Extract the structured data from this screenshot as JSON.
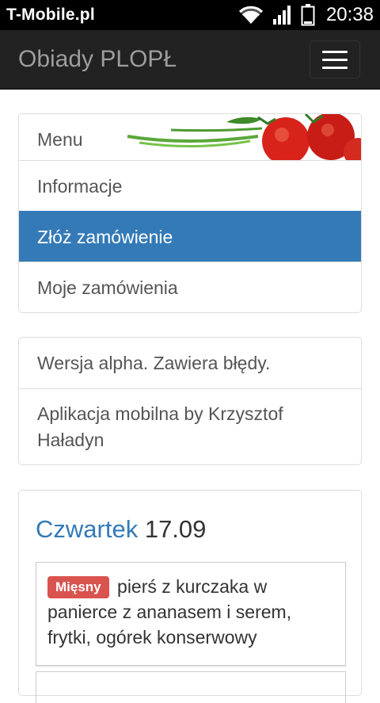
{
  "status_bar": {
    "carrier": "T-Mobile.pl",
    "time": "20:38",
    "icons": [
      "wifi-icon",
      "signal-icon",
      "battery-icon"
    ]
  },
  "navbar": {
    "brand": "Obiady PLOPŁ",
    "toggle_icon": "hamburger-menu-icon"
  },
  "menu": {
    "header": "Menu",
    "items": [
      {
        "label": "Informacje",
        "active": false
      },
      {
        "label": "Złóż zamówienie",
        "active": true
      },
      {
        "label": "Moje zamówienia",
        "active": false
      }
    ]
  },
  "info": {
    "lines": [
      "Wersja alpha. Zawiera błędy.",
      "Aplikacja mobilna by Krzysztof Haładyn"
    ]
  },
  "day": {
    "name": "Czwartek",
    "date": "17.09",
    "dishes": [
      {
        "badge": "Mięsny",
        "text": "pierś z kurczaka w panierce z ananasem i serem, frytki, ogórek konserwowy"
      }
    ]
  },
  "colors": {
    "accent": "#337ab7",
    "badge_meat": "#d9534f",
    "navbar_bg": "#222222"
  }
}
